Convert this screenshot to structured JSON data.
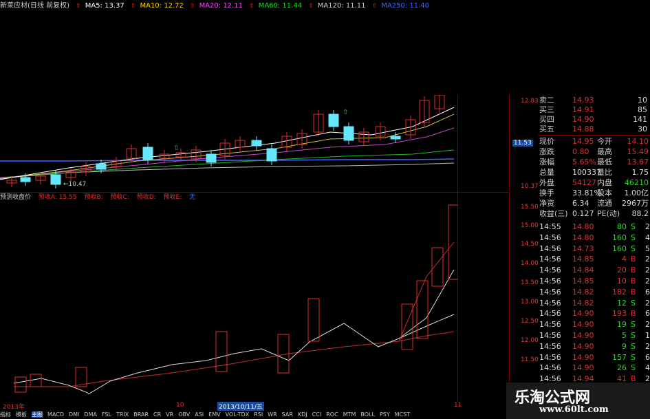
{
  "ma_bar": {
    "stock_title": "新莱应材(日线 前复权)",
    "ma5": "MA5: 13.37",
    "ma10": "MA10: 12.72",
    "ma20": "MA20: 12.11",
    "ma60": "MA60: 11.44",
    "ma120": "MA120: 11.11",
    "ma250": "MA250: 11.40"
  },
  "colors": {
    "ma5": "#ffffff",
    "ma10": "#ffd700",
    "ma20": "#ff44ff",
    "ma60": "#22dd22",
    "ma120": "#cccccc",
    "ma250": "#4466ff",
    "up": "#e03030",
    "down": "#66e6ff"
  },
  "main_axis": {
    "high": "12.83",
    "mid": "11.53",
    "low": "10.37",
    "low_marker": "←10.47"
  },
  "sub_bar": {
    "title": "预测收盘价",
    "a": "预收A: 15.55",
    "b": "预收B: ",
    "c": "预收C: ",
    "d": "预收D: ",
    "e": "预收E: ",
    "f": "无"
  },
  "sub_axis": [
    "15.50",
    "15.00",
    "14.50",
    "14.00",
    "13.50",
    "13.00",
    "12.50",
    "12.00",
    "11.50"
  ],
  "quote": {
    "sell_rows": [
      {
        "label": "卖二",
        "price": "14.93",
        "vol": "10"
      },
      {
        "label": "买三",
        "price": "14.91",
        "vol": "85"
      },
      {
        "label": "买四",
        "price": "14.90",
        "vol": "141"
      },
      {
        "label": "买五",
        "price": "14.88",
        "vol": "30"
      }
    ],
    "stat_rows": [
      {
        "l1": "现价",
        "v1": "14.95",
        "l2": "今开",
        "v2": "14.10"
      },
      {
        "l1": "涨跌",
        "v1": "0.80",
        "l2": "最高",
        "v2": "15.49"
      },
      {
        "l1": "涨幅",
        "v1": "5.65%",
        "l2": "最低",
        "v2": "13.67"
      },
      {
        "l1": "总量",
        "v1": "100337",
        "l2": "量比",
        "v2": "1.75"
      },
      {
        "l1": "外盘",
        "v1": "54127",
        "l2": "内盘",
        "v2": "46210"
      },
      {
        "l1": "换手",
        "v1": "33.81%",
        "l2": "股本",
        "v2": "1.00亿"
      },
      {
        "l1": "净资",
        "v1": "6.34",
        "l2": "流通",
        "v2": "2967万"
      },
      {
        "l1": "收益(三)",
        "v1": "0.127",
        "l2": "PE(动)",
        "v2": "88.2"
      }
    ]
  },
  "ticks": [
    {
      "t": "14:55",
      "p": "14.80",
      "v": "80",
      "s": "S",
      "n": "2"
    },
    {
      "t": "14:56",
      "p": "14.80",
      "v": "160",
      "s": "S",
      "n": "4"
    },
    {
      "t": "14:56",
      "p": "14.73",
      "v": "160",
      "s": "S",
      "n": "5"
    },
    {
      "t": "14:56",
      "p": "14.85",
      "v": "4",
      "s": "B",
      "n": "2"
    },
    {
      "t": "14:56",
      "p": "14.84",
      "v": "20",
      "s": "B",
      "n": "2"
    },
    {
      "t": "14:56",
      "p": "14.85",
      "v": "10",
      "s": "B",
      "n": "2"
    },
    {
      "t": "14:56",
      "p": "14.82",
      "v": "182",
      "s": "B",
      "n": "6"
    },
    {
      "t": "14:56",
      "p": "14.82",
      "v": "12",
      "s": "S",
      "n": "2"
    },
    {
      "t": "14:56",
      "p": "14.90",
      "v": "193",
      "s": "B",
      "n": "6"
    },
    {
      "t": "14:56",
      "p": "14.90",
      "v": "19",
      "s": "S",
      "n": "2"
    },
    {
      "t": "14:56",
      "p": "14.90",
      "v": "5",
      "s": "S",
      "n": "1"
    },
    {
      "t": "14:56",
      "p": "14.90",
      "v": "9",
      "s": "S",
      "n": "2"
    },
    {
      "t": "14:56",
      "p": "14.90",
      "v": "157",
      "s": "S",
      "n": "6"
    },
    {
      "t": "14:56",
      "p": "14.90",
      "v": "26",
      "s": "S",
      "n": "4"
    },
    {
      "t": "14:56",
      "p": "14.94",
      "v": "41",
      "s": "B",
      "n": "2"
    }
  ],
  "date_bar": {
    "year": "2013年",
    "d10": "10",
    "cursor_date": "2013/10/11/五",
    "d11": "11"
  },
  "tabs": [
    "指标",
    "模板",
    "主图",
    "MACD",
    "DMI",
    "DMA",
    "FSL",
    "TRIX",
    "BRAR",
    "CR",
    "VR",
    "OBV",
    "ASI",
    "EMV",
    "VOL-TDX",
    "RSI",
    "WR",
    "SAR",
    "KDJ",
    "CCI",
    "ROC",
    "MTM",
    "BOLL",
    "PSY",
    "MCST"
  ],
  "watermark": {
    "title": "乐淘公式网",
    "url": "www.60lt.com"
  }
}
